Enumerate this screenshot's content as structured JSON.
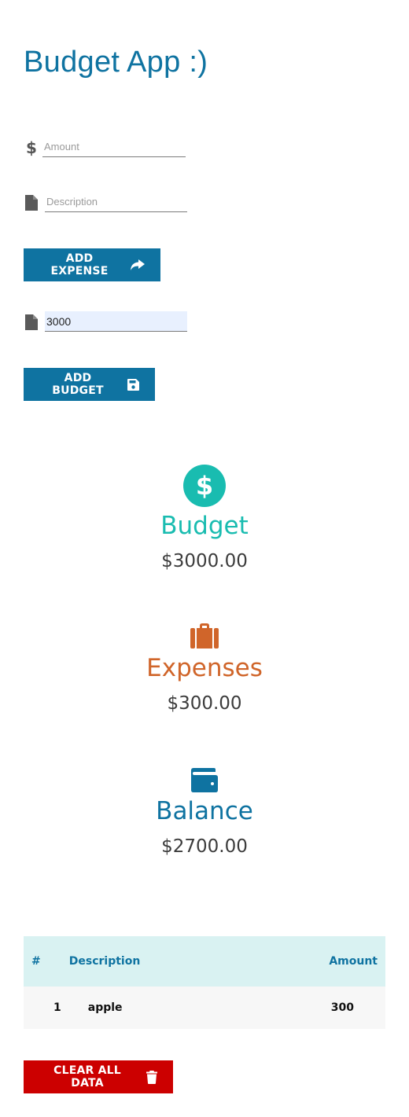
{
  "app": {
    "title": "Budget App :)"
  },
  "form": {
    "amount_placeholder": "Amount",
    "amount_value": "",
    "description_placeholder": "Description",
    "description_value": "",
    "add_expense_label": "ADD EXPENSE",
    "budget_value": "3000",
    "add_budget_label": "ADD BUDGET"
  },
  "summary": {
    "budget": {
      "label": "Budget",
      "value": "$3000.00",
      "color": "#19bcb0",
      "icon": "dollar-circle-icon"
    },
    "expenses": {
      "label": "Expenses",
      "value": "$300.00",
      "color": "#d0652a",
      "icon": "briefcase-icon"
    },
    "balance": {
      "label": "Balance",
      "value": "$2700.00",
      "color": "#0f73a1",
      "icon": "wallet-icon"
    }
  },
  "table": {
    "headers": {
      "num": "#",
      "description": "Description",
      "amount": "Amount"
    },
    "rows": [
      {
        "num": "1",
        "description": "apple",
        "amount": "300"
      }
    ]
  },
  "actions": {
    "clear_label": "CLEAR ALL DATA"
  },
  "colors": {
    "primary": "#0f73a1",
    "danger": "#cc0000",
    "header_bg": "#d9f2f2",
    "input_autofill": "#e8f0fe"
  }
}
